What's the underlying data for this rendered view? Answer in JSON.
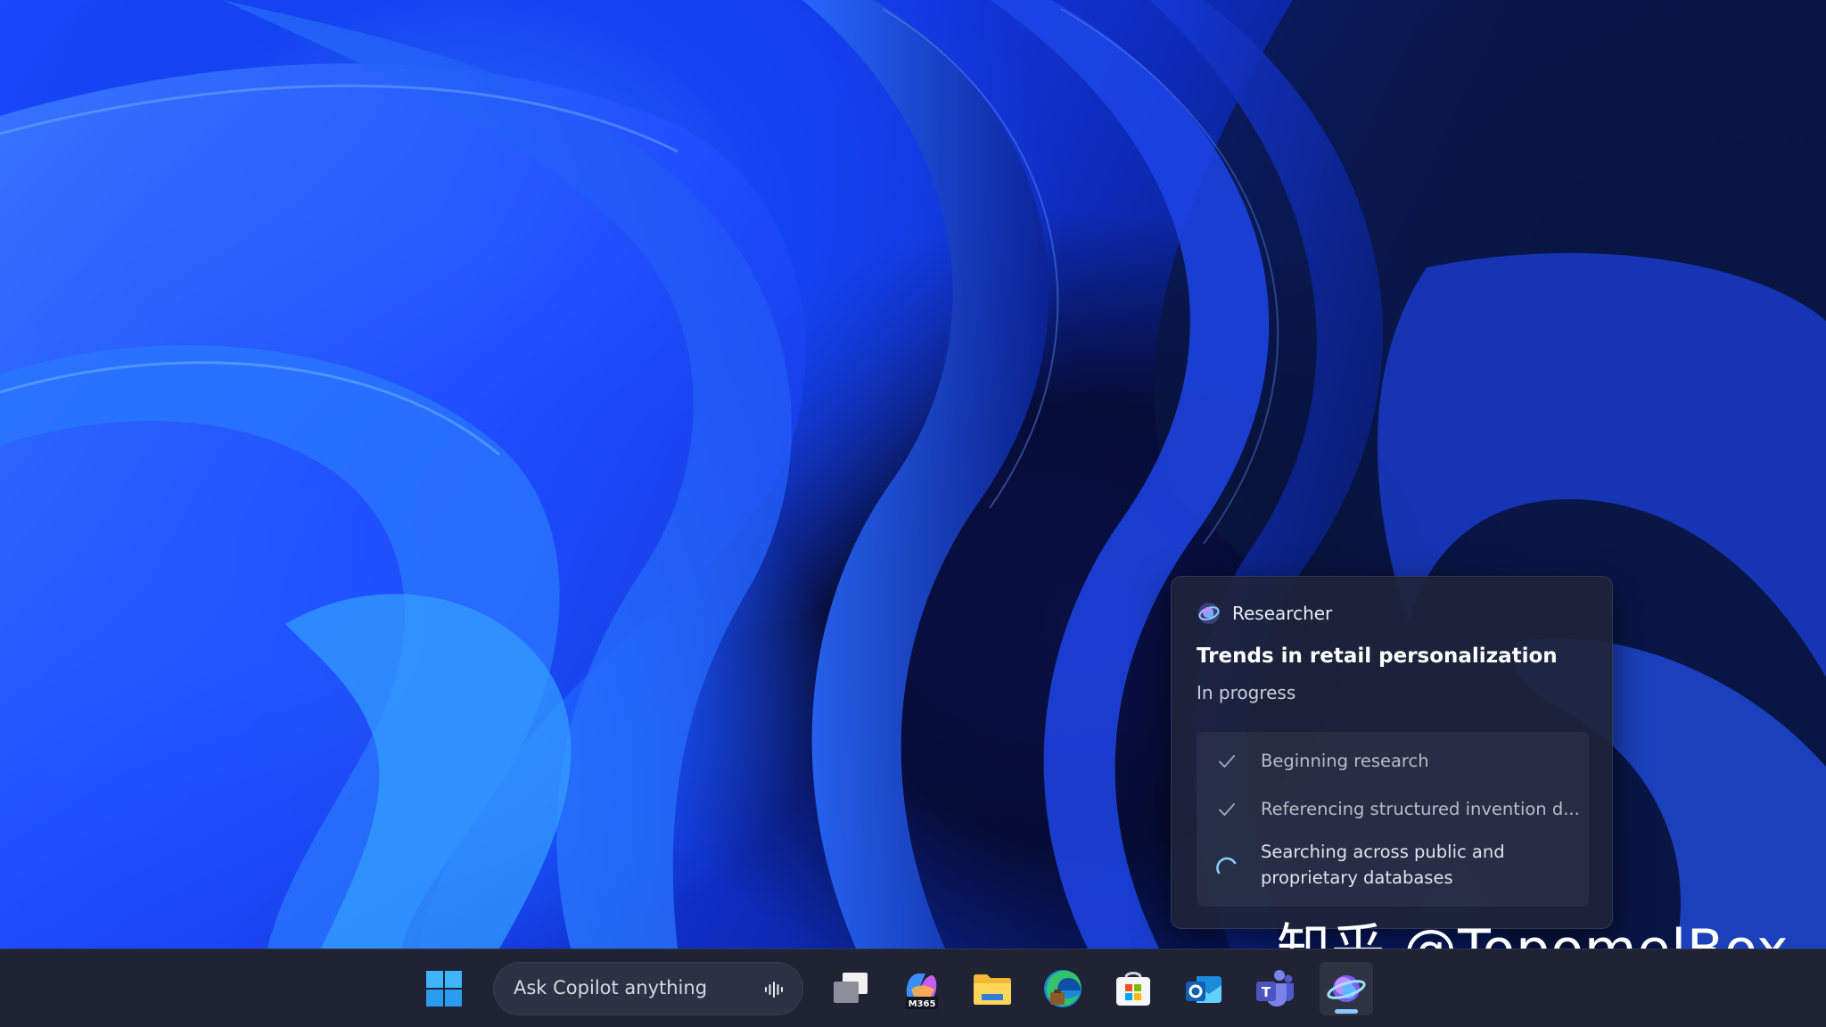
{
  "researcher_card": {
    "app_name": "Researcher",
    "title": "Trends in retail personalization",
    "status": "In progress",
    "steps": [
      {
        "label": "Beginning research",
        "state": "done"
      },
      {
        "label": "Referencing structured invention d...",
        "state": "done"
      },
      {
        "label": "Searching across public and proprietary databases",
        "state": "in-progress"
      }
    ]
  },
  "taskbar": {
    "search_placeholder": "Ask Copilot anything",
    "apps": [
      {
        "name": "start",
        "icon": "windows-logo-icon"
      },
      {
        "name": "task-view",
        "icon": "task-view-icon"
      },
      {
        "name": "m365-copilot",
        "icon": "m365-copilot-icon",
        "badge": "M365"
      },
      {
        "name": "file-explorer",
        "icon": "folder-icon"
      },
      {
        "name": "edge",
        "icon": "edge-icon"
      },
      {
        "name": "store",
        "icon": "store-icon"
      },
      {
        "name": "outlook",
        "icon": "outlook-icon"
      },
      {
        "name": "teams",
        "icon": "teams-icon"
      },
      {
        "name": "researcher",
        "icon": "researcher-icon",
        "active": true
      }
    ]
  },
  "watermark": {
    "text": "知乎 @TopomelBox"
  },
  "colors": {
    "wallpaper_blue": "#1a49ff",
    "taskbar_bg": "#1f2334",
    "card_bg": "#1e243a",
    "active_indicator": "#8bc7ff"
  }
}
